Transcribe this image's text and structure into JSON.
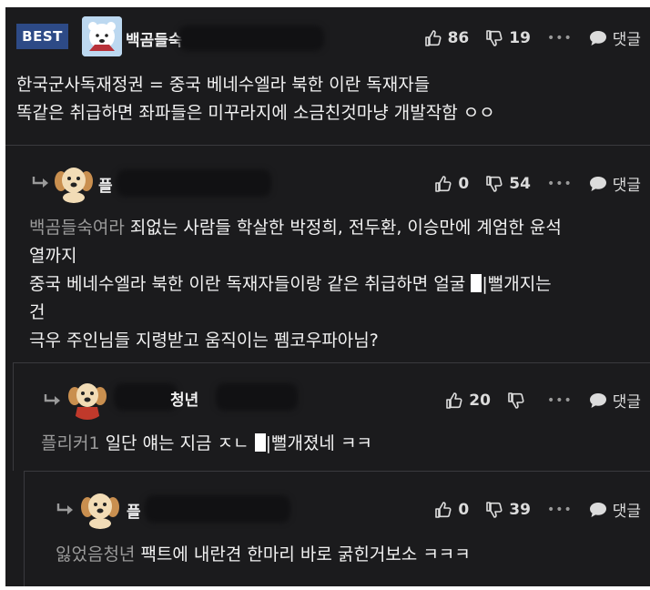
{
  "comments": [
    {
      "badge": "BEST",
      "nick_visible": "백곰들숙",
      "likes": "86",
      "dislikes": "19",
      "more": "•••",
      "reply_label": "댓글",
      "lines": [
        "한국군사독재정권 = 중국 베네수엘라 북한 이란 독재자들",
        "똑같은 취급하면 좌파들은 미꾸라지에 소금친것마냥 개발작함 ㅇㅇ"
      ]
    },
    {
      "nick_visible": "플",
      "likes": "0",
      "dislikes": "54",
      "more": "•••",
      "reply_label": "댓글",
      "mention": "백곰들숙여라",
      "lines": [
        " 죄없는 사람들 학살한 박정희, 전두환, 이승만에 계엄한 윤석",
        "열까지",
        "중국 베네수엘라 북한 이란 독재자들이랑 같은 취급하면 얼굴 ",
        "|뻘개지는",
        "건",
        "극우 주인님들 지령받고 움직이는 펨코우파아님?"
      ]
    },
    {
      "nick_visible": "청년",
      "likes": "20",
      "dislikes": "",
      "more": "•••",
      "reply_label": "댓글",
      "mention": "플리커1",
      "text_a": " 일단 얘는 지금 ㅈㄴ ",
      "text_b": "|뻘개졌네 ㅋㅋ"
    },
    {
      "nick_visible": "플",
      "likes": "0",
      "dislikes": "39",
      "more": "•••",
      "reply_label": "댓글",
      "mention": "잃었음청년",
      "text": " 팩트에 내란견 한마리 바로 굵힌거보소 ㅋㅋㅋ"
    }
  ],
  "icons": [
    "thumbs-up-icon",
    "thumbs-down-icon",
    "more-icon",
    "speech-bubble-icon",
    "reply-arrow-icon"
  ]
}
